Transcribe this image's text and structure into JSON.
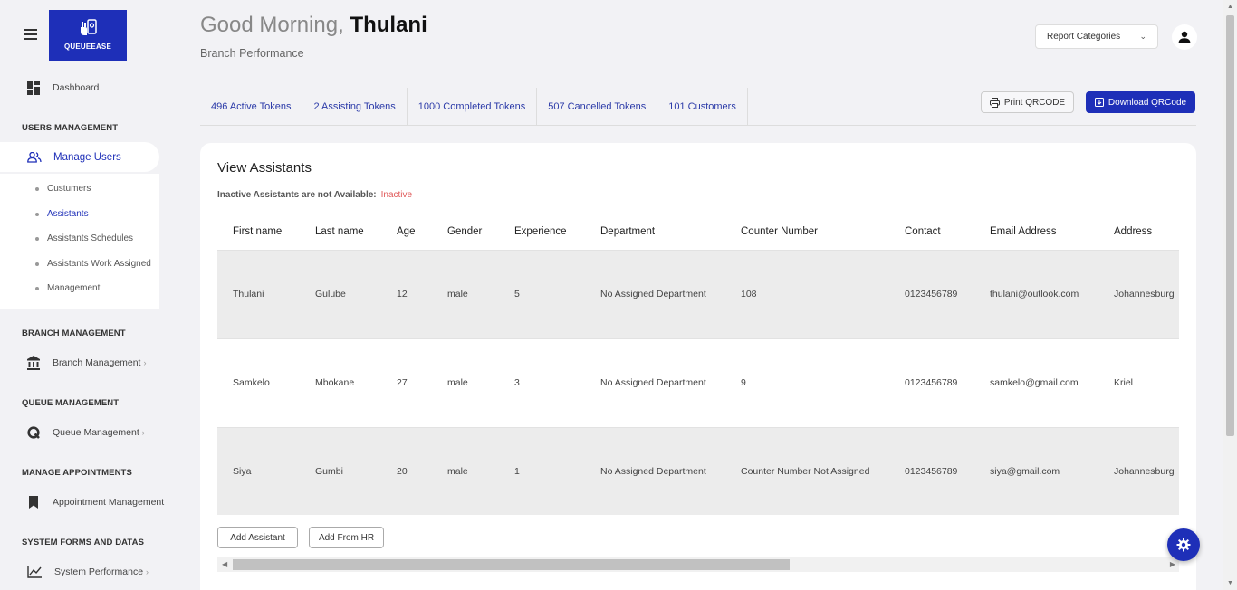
{
  "brand": {
    "name": "QUEUEEASE",
    "color": "#1e2fb8"
  },
  "sidebar": {
    "dashboard": "Dashboard",
    "sections": {
      "users": "USERS MANAGEMENT",
      "branch": "BRANCH MANAGEMENT",
      "queue": "QUEUE MANAGEMENT",
      "appointments": "MANAGE APPOINTMENTS",
      "system": "SYSTEM FORMS AND DATAS"
    },
    "manage_users": "Manage Users",
    "sub_items": [
      "Custumers",
      "Assistants",
      "Assistants Schedules",
      "Assistants Work Assigned",
      "Management"
    ],
    "branch_management": "Branch Management",
    "queue_management": "Queue Management",
    "appointment_management": "Appointment Management",
    "system_performance": "System Performance"
  },
  "header": {
    "greeting": "Good Morning,",
    "user_name": "Thulani",
    "subtitle": "Branch Performance",
    "report_select": "Report Categories"
  },
  "stats": [
    "496 Active Tokens",
    "2 Assisting Tokens",
    "1000 Completed Tokens",
    "507 Cancelled Tokens",
    "101 Customers"
  ],
  "actions": {
    "print": "Print QRCODE",
    "download": "Download QRCode"
  },
  "card": {
    "title": "View Assistants",
    "inactive_note": "Inactive Assistants are not Available:",
    "inactive_badge": "Inactive",
    "add_assistant": "Add Assistant",
    "add_from_hr": "Add From HR"
  },
  "table": {
    "columns": [
      "First name",
      "Last name",
      "Age",
      "Gender",
      "Experience",
      "Department",
      "Counter Number",
      "Contact",
      "Email Address",
      "Address"
    ],
    "rows": [
      [
        "Thulani",
        "Gulube",
        "12",
        "male",
        "5",
        "No Assigned Department",
        "108",
        "0123456789",
        "thulani@outlook.com",
        "Johannesburg"
      ],
      [
        "Samkelo",
        "Mbokane",
        "27",
        "male",
        "3",
        "No Assigned Department",
        "9",
        "0123456789",
        "samkelo@gmail.com",
        "Kriel"
      ],
      [
        "Siya",
        "Gumbi",
        "20",
        "male",
        "1",
        "No Assigned Department",
        "Counter Number Not Assigned",
        "0123456789",
        "siya@gmail.com",
        "Johannesburg"
      ]
    ]
  },
  "icons": [
    "menu-icon",
    "dashboard-icon",
    "users-icon",
    "bank-icon",
    "queue-icon",
    "bookmark-icon",
    "chart-icon",
    "user-icon",
    "printer-icon",
    "download-icon",
    "gear-icon"
  ]
}
